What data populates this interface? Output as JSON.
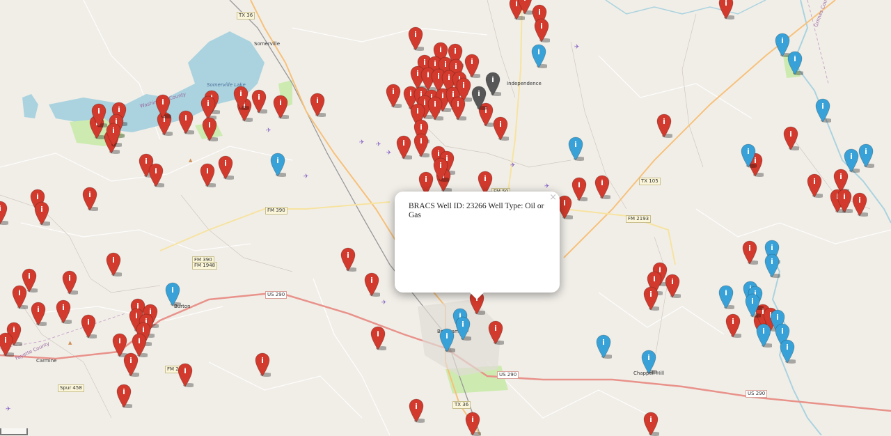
{
  "map": {
    "popup": {
      "content": "BRACS Well ID: 23266 Well Type: Oil or Gas",
      "close_label": "×"
    },
    "towns": [
      "Somerville",
      "Independence",
      "Burton",
      "Brenham",
      "Chappell Hill",
      "Carmine"
    ],
    "lakes": [
      "Somerville Lake"
    ],
    "counties": [
      "Washington County",
      "Fayette County",
      "Grimes County"
    ],
    "highways": [
      "TX 36",
      "FM 50",
      "TX 105",
      "FM 390",
      "FM 2193",
      "FM 390",
      "FM 1948",
      "US 290",
      "TX 36",
      "US 290",
      "US 290",
      "FM 290",
      "Spur 458"
    ],
    "marker_colors": {
      "oil_gas": "#d13a2c",
      "water": "#38a2d8",
      "other": "#575757"
    },
    "markers": {
      "red_count": 180,
      "blue_count": 25,
      "gray_count": 2
    }
  }
}
